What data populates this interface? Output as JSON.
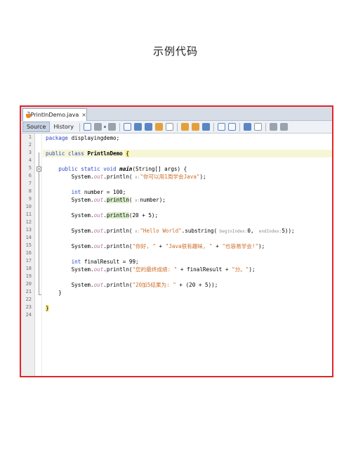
{
  "page_title": "示例代码",
  "tab": {
    "filename": "PrintlnDemo.java",
    "close": "×"
  },
  "toolbar": {
    "source_label": "Source",
    "history_label": "History"
  },
  "lines": [
    "1",
    "2",
    "3",
    "4",
    "5",
    "6",
    "7",
    "8",
    "9",
    "10",
    "11",
    "12",
    "13",
    "14",
    "15",
    "16",
    "17",
    "18",
    "19",
    "20",
    "21",
    "22",
    "23",
    "24"
  ],
  "code": {
    "l1": {
      "kw": "package",
      "rest": " displayingdemo;"
    },
    "l3": {
      "kw": "public class",
      "cls": "PrintlnDemo",
      "brace": "{"
    },
    "l5": {
      "kw": "public static void",
      "mth": "main",
      "rest": "(String[] args) {"
    },
    "l6": {
      "pre": "System.",
      "out": "out",
      "mid": ".println(",
      "hint": " x:",
      "str": "\"你可以用1周学会Java\"",
      "post": ");"
    },
    "l8": {
      "kw": "int",
      "rest": " number = 100;"
    },
    "l9": {
      "pre": "System.",
      "out": "out",
      "mid": ".",
      "word": "println",
      "paren": "(",
      "hint": " x:",
      "post": "number);"
    },
    "l11": {
      "pre": "System.",
      "out": "out",
      "mid": ".",
      "word": "println",
      "post": "(20 + 5);"
    },
    "l13": {
      "pre": "System.",
      "out": "out",
      "mid": ".println(",
      "hint": " x:",
      "str": "\"Hello World\"",
      "sub": ".substring(",
      "hint2": " beginIndex:",
      "n1": "0,",
      "hint3": "  endIndex:",
      "n2": "5));"
    },
    "l15": {
      "pre": "System.",
      "out": "out",
      "mid": ".println(",
      "s1": "\"你好, \"",
      "op1": " + ",
      "s2": "\"Java很有趣味, \"",
      "op2": " + ",
      "s3": "\"也容易学会!\"",
      "post": ");"
    },
    "l17": {
      "kw": "int",
      "rest": " finalResult = 99;"
    },
    "l18": {
      "pre": "System.",
      "out": "out",
      "mid": ".println(",
      "s1": "\"您的最终成绩: \"",
      "op1": " + finalResult + ",
      "s2": "\"分。\"",
      "post": ");"
    },
    "l20": {
      "pre": "System.",
      "out": "out",
      "mid": ".println(",
      "s1": "\"20加5结果为: \"",
      "post": " + (20 + 5));"
    },
    "l21": "}",
    "l23": "}"
  },
  "icons": [
    "back-icon",
    "forward-icon",
    "find-icon",
    "prev-occurrence-icon",
    "next-occurrence-icon",
    "toggle-highlight-icon",
    "toggle-rect-select-icon",
    "prev-bookmark-icon",
    "next-bookmark-icon",
    "toggle-bookmark-icon",
    "shift-left-icon",
    "shift-right-icon",
    "start-macro-icon",
    "stop-macro-icon",
    "comment-icon",
    "uncomment-icon"
  ],
  "colors": {
    "frame_border": "#e0252c",
    "keyword": "#2d46c7",
    "string": "#cd6b24",
    "field": "#b5739e",
    "current_line": "#f6f6d7"
  }
}
